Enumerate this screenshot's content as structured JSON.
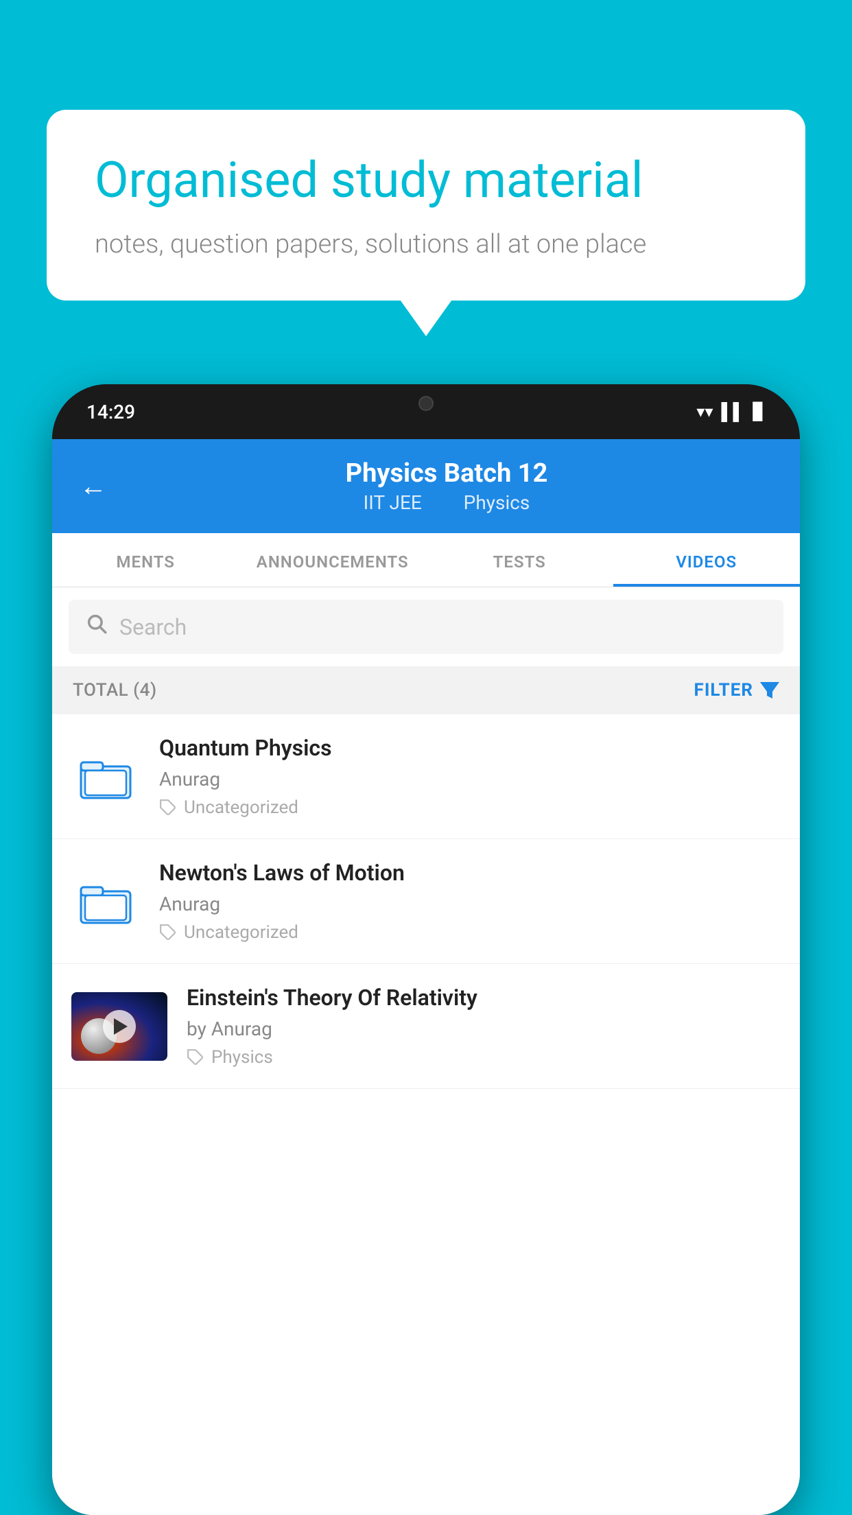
{
  "background_color": "#00bcd4",
  "speech_bubble": {
    "heading": "Organised study material",
    "subtext": "notes, question papers, solutions all at one place"
  },
  "phone": {
    "status_bar": {
      "time": "14:29"
    },
    "app": {
      "header": {
        "back_label": "←",
        "title": "Physics Batch 12",
        "subtitle_part1": "IIT JEE",
        "subtitle_part2": "Physics"
      },
      "tabs": [
        {
          "label": "MENTS",
          "active": false
        },
        {
          "label": "ANNOUNCEMENTS",
          "active": false
        },
        {
          "label": "TESTS",
          "active": false
        },
        {
          "label": "VIDEOS",
          "active": true
        }
      ],
      "search": {
        "placeholder": "Search"
      },
      "filter_bar": {
        "total_label": "TOTAL (4)",
        "filter_label": "FILTER"
      },
      "videos": [
        {
          "id": 1,
          "title": "Quantum Physics",
          "author": "Anurag",
          "tag": "Uncategorized",
          "type": "folder"
        },
        {
          "id": 2,
          "title": "Newton's Laws of Motion",
          "author": "Anurag",
          "tag": "Uncategorized",
          "type": "folder"
        },
        {
          "id": 3,
          "title": "Einstein's Theory Of Relativity",
          "author": "by Anurag",
          "tag": "Physics",
          "type": "video"
        }
      ]
    }
  }
}
